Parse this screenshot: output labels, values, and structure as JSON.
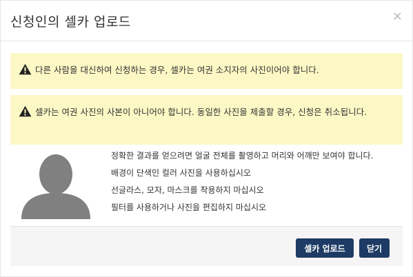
{
  "dialog": {
    "title": "신청인의 셀카 업로드",
    "close_glyph": "×"
  },
  "alerts": [
    {
      "icon": "warning-icon",
      "text": "다른 사람을 대신하여 신청하는 경우, 셀카는 여권 소지자의 사진이어야 합니다."
    },
    {
      "icon": "warning-icon",
      "text": "셀카는 여권 사진의 사본이 아니어야 합니다. 동일한 사진을 제출할 경우, 신청은 취소됩니다."
    }
  ],
  "guidelines": [
    "정확한 결과를 얻으려면 얼굴 전체를 촬영하고 머리와 어깨만 보여야 합니다.",
    "배경이 단색인 컬러 사진을 사용하십시오",
    "선글라스, 모자, 마스크를 착용하지 마십시오",
    "필터를 사용하거나 사진을 편집하지 마십시오"
  ],
  "footer": {
    "upload_label": "셀카 업로드",
    "close_label": "닫기"
  },
  "colors": {
    "alert_bg": "#fcf8c5",
    "button_bg": "#1d3b64",
    "avatar_gray": "#808080"
  }
}
